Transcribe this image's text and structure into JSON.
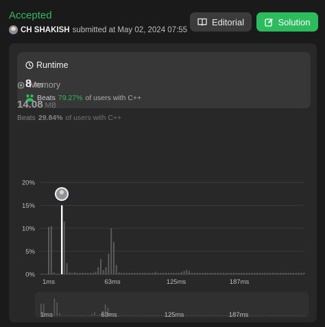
{
  "header": {
    "status": "Accepted",
    "username": "CH SHAKISH",
    "submitted_text": "submitted at May 02, 2024 07:55"
  },
  "buttons": {
    "editorial": "Editorial",
    "solution": "Solution"
  },
  "runtime": {
    "title": "Runtime",
    "value": "8",
    "unit": "ms",
    "beats_prefix": "Beats",
    "beats_pct": "79.27%",
    "beats_suffix": "of users with C++"
  },
  "memory": {
    "title": "Memory",
    "value": "14.08",
    "unit": "MB",
    "beats_prefix": "Beats",
    "beats_pct": "29.84%",
    "beats_suffix": "of users with C++"
  },
  "colors": {
    "accent": "#2cbb5d",
    "bar": "#5b5b5b",
    "highlight": "#ffffff"
  },
  "chart_data": {
    "type": "bar",
    "ylim": [
      0,
      20
    ],
    "y_ticks": [
      "20%",
      "15%",
      "10%",
      "5%",
      "0%"
    ],
    "x_ticks": [
      "1ms",
      "63ms",
      "125ms",
      "187ms"
    ],
    "mini_x_ticks": [
      "1ms",
      "63ms",
      "125ms",
      "187ms"
    ],
    "highlight_index": 5,
    "values": [
      10.3,
      10.5,
      0.4,
      0,
      0,
      15.0,
      11.5,
      2.4,
      0.4,
      0.3,
      0.4,
      0.3,
      0.3,
      0.3,
      0.3,
      0.3,
      0.3,
      0.3,
      0.5,
      1.5,
      3.3,
      0.9,
      1.5,
      4.5,
      10.0,
      7.0,
      2.0,
      0.4,
      0.3,
      0.3,
      0.3,
      0.3,
      0.3,
      0.3,
      0.3,
      0.3,
      0.3,
      0.3,
      0.3,
      0.3,
      0.3,
      0.5,
      0.3,
      0.3,
      0.3,
      0.3,
      0.3,
      0.3,
      0.3,
      0.3,
      0.3,
      0.5,
      0.7,
      0.9,
      0.7,
      0.3,
      0.3,
      0.3,
      0.3,
      0.3,
      0.3,
      0.3,
      0.3,
      0.3,
      0.3,
      0.3,
      0.3,
      0.3,
      0.3,
      0.3,
      0.3,
      0.3,
      0.3,
      0.3,
      0.3,
      0.3,
      0.3,
      0.3,
      0.3,
      0.3,
      0.3,
      0.3,
      0.3,
      0.3,
      0.3,
      0.3,
      0.3,
      0.3,
      0.3,
      0.3,
      0.3,
      0.3,
      0.3,
      0.3,
      0.3,
      0.3,
      0.3,
      0.3,
      0.3
    ]
  }
}
